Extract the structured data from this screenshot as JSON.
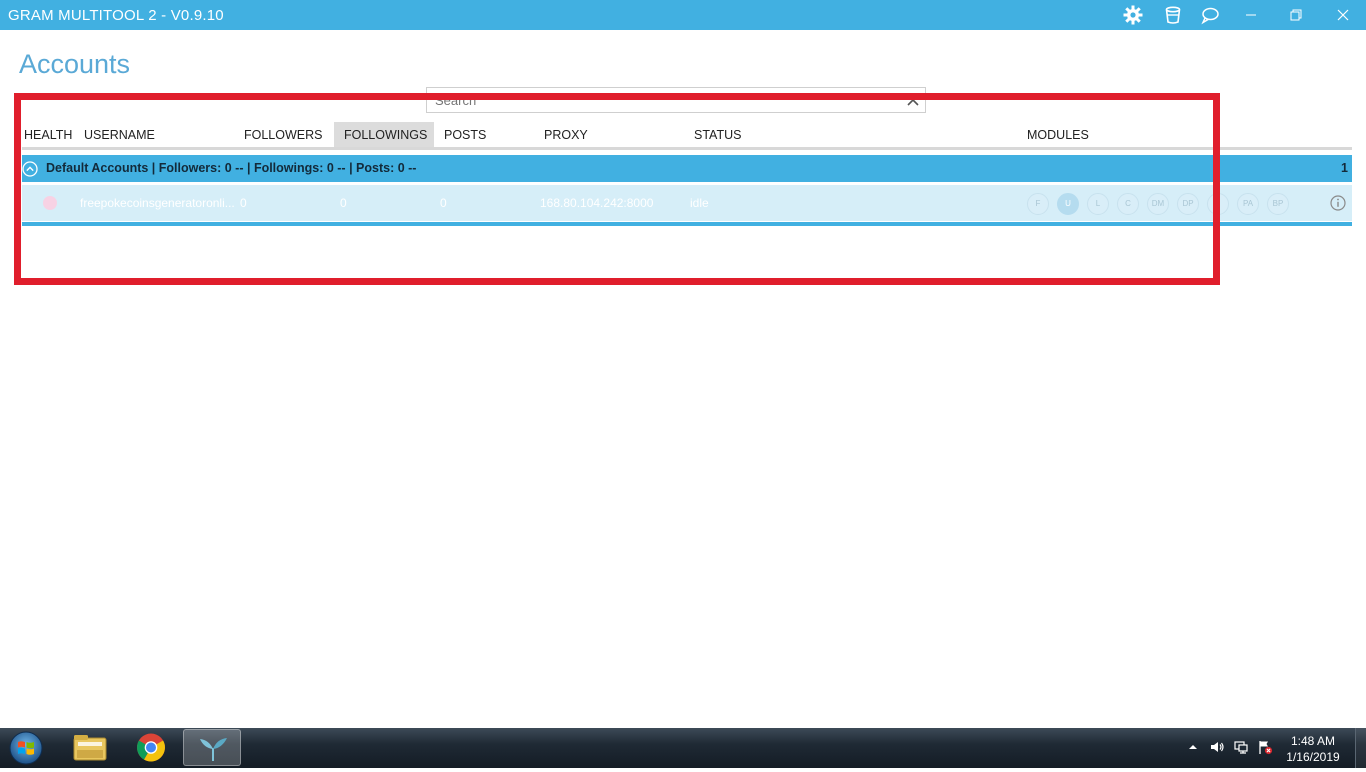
{
  "window": {
    "title": "GRAM MULTITOOL 2 - V0.9.10",
    "icons": [
      "gear-icon",
      "bucket-icon",
      "chat-icon"
    ],
    "controls": [
      "minimize",
      "restore",
      "close"
    ]
  },
  "page": {
    "title": "Accounts"
  },
  "search": {
    "placeholder": "Search",
    "value": ""
  },
  "table": {
    "columns": {
      "health": "HEALTH",
      "username": "USERNAME",
      "followers": "FOLLOWERS",
      "followings": "FOLLOWINGS",
      "posts": "POSTS",
      "proxy": "PROXY",
      "status": "STATUS",
      "modules": "MODULES"
    },
    "active_column": "followings",
    "group": {
      "label": "Default Accounts | Followers: 0 -- | Followings: 0 -- | Posts: 0 --",
      "count": "1"
    },
    "rows": [
      {
        "health_color": "#f7d2e4",
        "username": "freepokecoinsgeneratoronli...",
        "followers": "0",
        "followings": "0",
        "posts": "0",
        "proxy": "168.80.104.242:8000",
        "status": "idle",
        "modules": {
          "m1": "F",
          "m2": "U",
          "m3": "L",
          "m4": "C",
          "m5": "DM",
          "m6": "DP",
          "m7": "",
          "m8": "PA",
          "m9": "BP"
        }
      }
    ]
  },
  "taskbar": {
    "apps": [
      "windows-explorer",
      "google-chrome",
      "gram-multitool"
    ],
    "clock": {
      "time": "1:48 AM",
      "date": "1/16/2019"
    }
  },
  "colors": {
    "accent": "#41b0e1",
    "highlight_box": "#e01e2c",
    "row_bg": "#d6eef8"
  }
}
